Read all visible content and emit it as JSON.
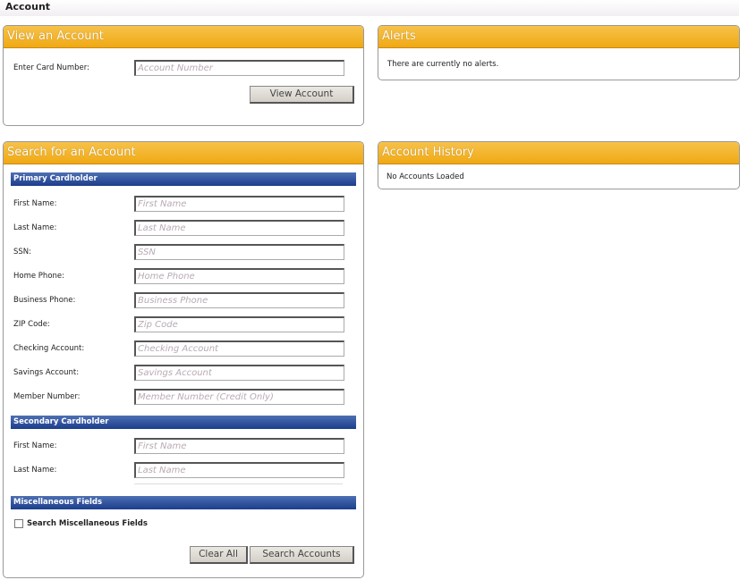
{
  "page_title": "Account",
  "view_account": {
    "title": "View an Account",
    "label": "Enter Card Number:",
    "placeholder": "Account Number",
    "button": "View Account"
  },
  "alerts": {
    "title": "Alerts",
    "message": "There are currently no alerts."
  },
  "history": {
    "title": "Account History",
    "message": "No Accounts Loaded"
  },
  "search": {
    "title": "Search for an Account",
    "primary": {
      "heading": "Primary Cardholder",
      "fields": [
        {
          "label": "First Name:",
          "placeholder": "First Name"
        },
        {
          "label": "Last Name:",
          "placeholder": "Last Name"
        },
        {
          "label": "SSN:",
          "placeholder": "SSN"
        },
        {
          "label": "Home Phone:",
          "placeholder": "Home Phone"
        },
        {
          "label": "Business Phone:",
          "placeholder": "Business Phone"
        },
        {
          "label": "ZIP Code:",
          "placeholder": "Zip Code"
        },
        {
          "label": "Checking Account:",
          "placeholder": "Checking Account"
        },
        {
          "label": "Savings Account:",
          "placeholder": "Savings Account"
        },
        {
          "label": "Member Number:",
          "placeholder": "Member Number (Credit Only)"
        }
      ]
    },
    "secondary": {
      "heading": "Secondary Cardholder",
      "fields": [
        {
          "label": "First Name:",
          "placeholder": "First Name"
        },
        {
          "label": "Last Name:",
          "placeholder": "Last Name"
        }
      ]
    },
    "misc": {
      "heading": "Miscellaneous Fields",
      "checkbox_label": "Search Miscellaneous Fields",
      "checked": false
    },
    "clear_button": "Clear All",
    "search_button": "Search Accounts"
  }
}
